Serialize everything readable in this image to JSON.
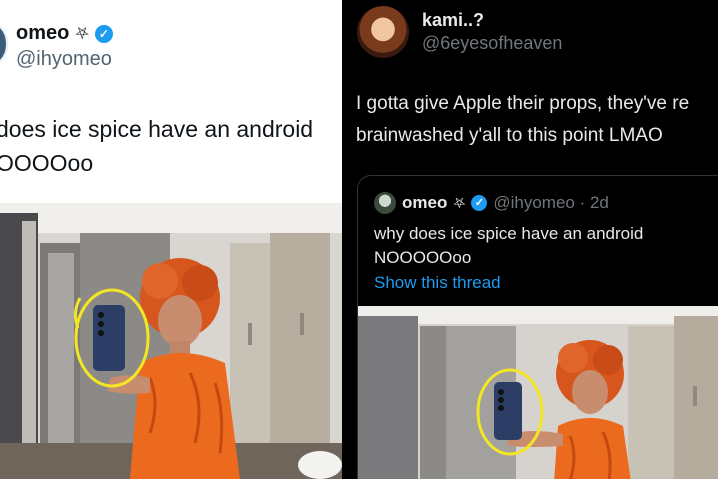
{
  "left_tweet": {
    "author_name": "omeo",
    "author_symbol": "⛧",
    "handle": "@ihyomeo",
    "text": "does ice spice have an android\nOOOOoo"
  },
  "right_tweet": {
    "author_name": "kami..?",
    "handle": "@6eyesofheaven",
    "text": "I gotta give Apple their props, they've re\nbrainwashed y'all to this point LMAO",
    "quote": {
      "author_name": "omeo",
      "author_symbol": "⛧",
      "handle_time": "@ihyomeo · 2d",
      "text": "why does ice spice have an android\nNOOOOOoo",
      "link_label": "Show this thread"
    }
  },
  "colors": {
    "verified_blue": "#1d9bf0",
    "dark_bg": "#000000",
    "light_bg": "#ffffff",
    "highlight_circle": "#f4e525",
    "hair": "#d6561e",
    "dress": "#ec6a1d"
  },
  "icons": [
    "verified-badge-icon",
    "pentagram-icon"
  ]
}
